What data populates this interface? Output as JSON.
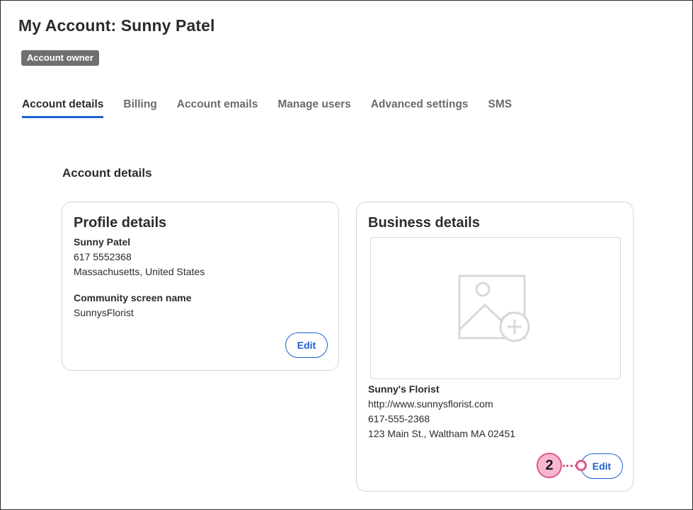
{
  "page": {
    "title": "My Account: Sunny Patel",
    "badge": "Account owner"
  },
  "tabs": [
    {
      "label": "Account details",
      "active": true
    },
    {
      "label": "Billing",
      "active": false
    },
    {
      "label": "Account emails",
      "active": false
    },
    {
      "label": "Manage users",
      "active": false
    },
    {
      "label": "Advanced settings",
      "active": false
    },
    {
      "label": "SMS",
      "active": false
    }
  ],
  "section_heading": "Account details",
  "profile_card": {
    "title": "Profile details",
    "name": "Sunny Patel",
    "phone": "617 5552368",
    "location": "Massachusetts, United States",
    "community_label": "Community screen name",
    "community_value": "SunnysFlorist",
    "edit_label": "Edit"
  },
  "business_card": {
    "title": "Business details",
    "image_icon": "add-image-icon",
    "business_name": "Sunny's Florist",
    "website": "http://www.sunnysflorist.com",
    "phone": "617-555-2368",
    "address": "123 Main St., Waltham MA 02451",
    "edit_label": "Edit"
  },
  "callout": {
    "number": "2"
  },
  "colors": {
    "accent": "#1f5fd1",
    "badge_bg": "#6f6f6f",
    "callout": "#e0558d",
    "callout_fill": "#f7b6cf"
  }
}
